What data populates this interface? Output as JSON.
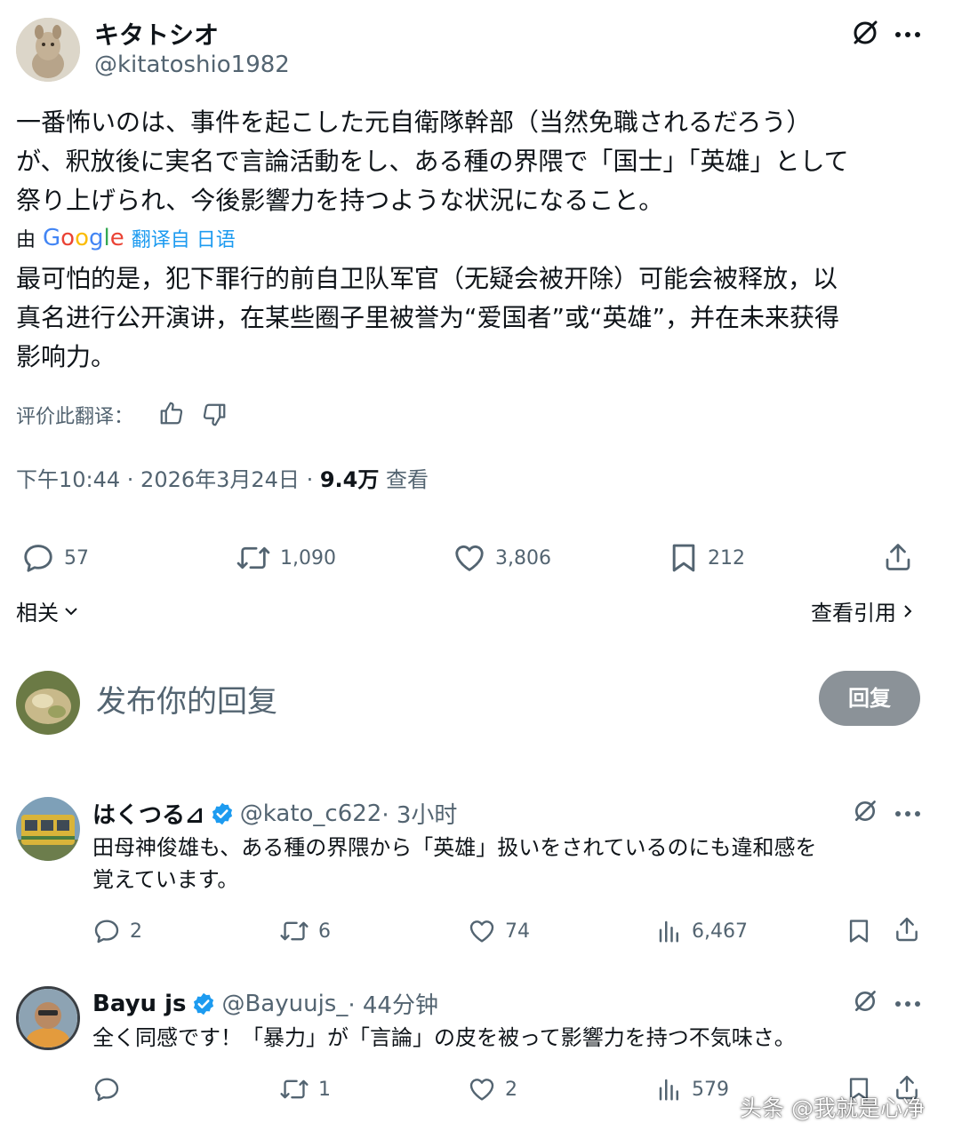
{
  "tweet": {
    "display_name": "キタトシオ",
    "handle": "@kitatoshio1982",
    "text_lines": [
      "一番怖いのは、事件を起こした元自衛隊幹部（当然免職されるだろう）",
      "が、釈放後に実名で言論活動をし、ある種の界隈で「国士」「英雄」として",
      "祭り上げられ、今後影響力を持つような状況になること。"
    ],
    "translate_by": "由",
    "google": [
      "G",
      "o",
      "o",
      "g",
      "l",
      "e"
    ],
    "google_colors": [
      "#4285F4",
      "#EA4335",
      "#FBBC05",
      "#4285F4",
      "#34A853",
      "#EA4335"
    ],
    "translated_from": "翻译自 日语",
    "translation_lines": [
      "最可怕的是，犯下罪行的前自卫队军官（无疑会被开除）可能会被释放，以",
      "真名进行公开演讲，在某些圈子里被誉为“爱国者”或“英雄”，并在未来获得",
      "影响力。"
    ],
    "rate_label": "评价此翻译：",
    "time": "下午10:44 · 2026年3月24日 · ",
    "views_count": "9.4万",
    "views_label": " 查看",
    "replies": "57",
    "reposts": "1,090",
    "likes": "3,806",
    "bookmarks": "212",
    "related_label": "相关",
    "quotes_label": "查看引用"
  },
  "composer": {
    "placeholder": "发布你的回复",
    "reply_button": "回复"
  },
  "replies": [
    {
      "display_name": "はくつる⊿",
      "handle": "@kato_c622",
      "time": " · 3小时",
      "text_lines": [
        "田母神俊雄も、ある種の界隈から「英雄」扱いをされているのにも違和感を",
        "覚えています。"
      ],
      "replies": "2",
      "reposts": "6",
      "likes": "74",
      "views": "6,467"
    },
    {
      "display_name": "Bayu js",
      "handle": "@Bayuujs_",
      "time": " · 44分钟",
      "text_lines": [
        "全く同感です！「暴力」が「言論」の皮を被って影響力を持つ不気味さ。"
      ],
      "replies": "",
      "reposts": "1",
      "likes": "2",
      "views": "579"
    }
  ],
  "watermark": "头条 @我就是心净",
  "colors": {
    "text": "#0f1419",
    "secondary": "#536471",
    "verified": "#1d9bf0",
    "reply_button_bg": "#8b9298"
  }
}
